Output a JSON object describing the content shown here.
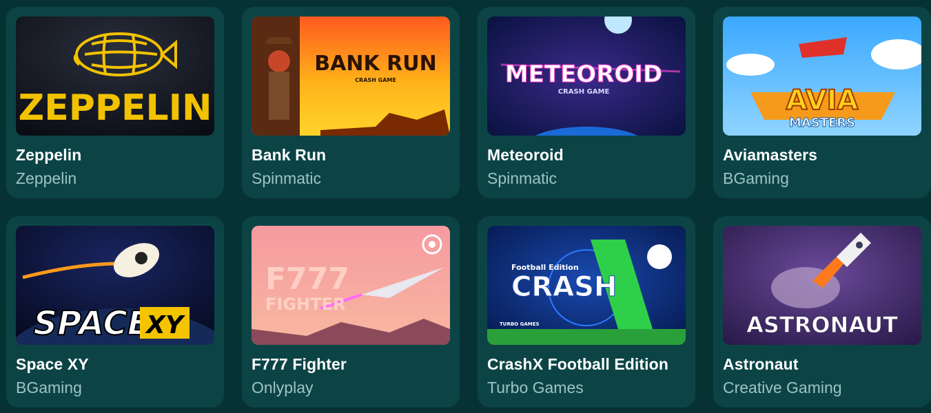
{
  "games": [
    {
      "title": "Zeppelin",
      "provider": "Zeppelin",
      "thumb_text": "ZEPPELIN"
    },
    {
      "title": "Bank Run",
      "provider": "Spinmatic",
      "thumb_text": "BANK RUN",
      "thumb_sub": "CRASH GAME"
    },
    {
      "title": "Meteoroid",
      "provider": "Spinmatic",
      "thumb_text": "METEOROID",
      "thumb_sub": "CRASH GAME"
    },
    {
      "title": "Aviamasters",
      "provider": "BGaming",
      "thumb_text": "AVIA",
      "thumb_sub": "MASTERS"
    },
    {
      "title": "Space XY",
      "provider": "BGaming",
      "thumb_text": "SPACE",
      "thumb_sub": "XY"
    },
    {
      "title": "F777 Fighter",
      "provider": "Onlyplay",
      "thumb_text": "F777",
      "thumb_sub": "FIGHTER"
    },
    {
      "title": "CrashX Football Edition",
      "provider": "Turbo Games",
      "thumb_text": "CRASH",
      "thumb_sub": "Football Edition",
      "thumb_small": "TURBO GAMES"
    },
    {
      "title": "Astronaut",
      "provider": "Creative Gaming",
      "thumb_text": "ASTRONAUT"
    }
  ],
  "colors": {
    "background": "#073234",
    "card": "#0c4446",
    "title": "#ffffff",
    "provider": "#9fc3c4"
  }
}
